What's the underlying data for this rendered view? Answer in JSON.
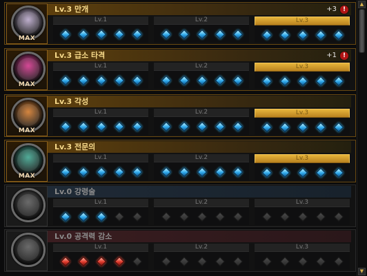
{
  "max_label": "MAX",
  "level_labels": [
    "Lv.1",
    "Lv.2",
    "Lv.3"
  ],
  "colors": {
    "gold_accent": "#e7b53b",
    "blue_gem": "#2fa8ea",
    "red_gem": "#e03a2c",
    "inactive_gem": "#3a3a3a"
  },
  "skills": [
    {
      "title": "Lv.3 만개",
      "badge": "+3",
      "max": true,
      "theme": "gold",
      "active_level": 3,
      "icon": "burst-skill-icon",
      "icon_color": "#b7a6c8",
      "gems": [
        [
          "blue",
          "blue",
          "blue",
          "blue",
          "blue"
        ],
        [
          "blue",
          "blue",
          "blue",
          "blue",
          "blue"
        ],
        [
          "blue",
          "blue",
          "blue",
          "blue",
          "blue"
        ]
      ]
    },
    {
      "title": "Lv.3 급소 타격",
      "badge": "+1",
      "max": true,
      "theme": "gold",
      "active_level": 3,
      "icon": "vital-strike-icon",
      "icon_color": "#d0348a",
      "gems": [
        [
          "blue",
          "blue",
          "blue",
          "blue",
          "blue"
        ],
        [
          "blue",
          "blue",
          "blue",
          "blue",
          "blue"
        ],
        [
          "blue",
          "blue",
          "blue",
          "blue",
          "blue"
        ]
      ]
    },
    {
      "title": "Lv.3 각성",
      "badge": "",
      "max": true,
      "theme": "gold",
      "active_level": 3,
      "icon": "awakening-icon",
      "icon_color": "#d0782a",
      "gems": [
        [
          "blue",
          "blue",
          "blue",
          "blue",
          "blue"
        ],
        [
          "blue",
          "blue",
          "blue",
          "blue",
          "blue"
        ],
        [
          "blue",
          "blue",
          "blue",
          "blue",
          "blue"
        ]
      ]
    },
    {
      "title": "Lv.3 전문의",
      "badge": "",
      "max": true,
      "theme": "gold",
      "active_level": 3,
      "icon": "specialist-icon",
      "icon_color": "#3ea38d",
      "gems": [
        [
          "blue",
          "blue",
          "blue",
          "blue",
          "blue"
        ],
        [
          "blue",
          "blue",
          "blue",
          "blue",
          "blue"
        ],
        [
          "blue",
          "blue",
          "blue",
          "blue",
          "blue"
        ]
      ]
    },
    {
      "title": "Lv.0 강령술",
      "badge": "",
      "max": false,
      "theme": "blue",
      "active_level": 0,
      "icon": "necromancy-icon",
      "icon_color": "#5a5a5a",
      "gems": [
        [
          "blue",
          "blue",
          "blue",
          "off",
          "off"
        ],
        [
          "off",
          "off",
          "off",
          "off",
          "off"
        ],
        [
          "off",
          "off",
          "off",
          "off",
          "off"
        ]
      ]
    },
    {
      "title": "Lv.0 공격력 감소",
      "badge": "",
      "max": false,
      "theme": "red",
      "active_level": 0,
      "icon": "attack-reduction-icon",
      "icon_color": "#5a5a5a",
      "gems": [
        [
          "red",
          "red",
          "red",
          "red",
          "off"
        ],
        [
          "off",
          "off",
          "off",
          "off",
          "off"
        ],
        [
          "off",
          "off",
          "off",
          "off",
          "off"
        ]
      ]
    }
  ],
  "scrollbar": {
    "up_icon": "arrow-up-icon",
    "down_icon": "arrow-down-icon",
    "up_glyph": "▲",
    "down_glyph": "▼"
  }
}
